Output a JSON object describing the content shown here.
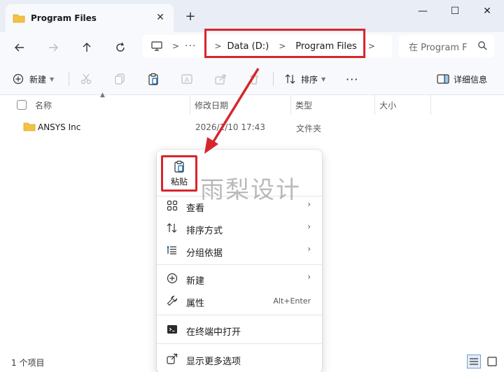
{
  "window": {
    "tab_title": "Program Files",
    "tab_close": "✕",
    "new_tab": "+",
    "minimize": "—",
    "maximize": "☐",
    "close": "✕"
  },
  "nav": {
    "more": "···",
    "sep": ">",
    "crumbs": [
      "Data (D:)",
      "Program Files"
    ],
    "search_placeholder": "在 Program F"
  },
  "toolbar": {
    "new_label": "新建",
    "sort_label": "排序",
    "more": "···",
    "details_label": "详细信息"
  },
  "columns": [
    "名称",
    "修改日期",
    "类型",
    "大小"
  ],
  "files": [
    {
      "name": "ANSYS Inc",
      "date": "2026/1/10 17:43",
      "type": "文件夹",
      "size": ""
    }
  ],
  "status": {
    "count": "1 个项目"
  },
  "context_menu": {
    "paste": "粘贴",
    "items": [
      {
        "label": "查看",
        "icon": "grid-view-icon",
        "submenu": true
      },
      {
        "label": "排序方式",
        "icon": "sort-icon",
        "submenu": true
      },
      {
        "label": "分组依据",
        "icon": "group-icon",
        "submenu": true
      },
      {
        "label": "新建",
        "icon": "plus-circle-icon",
        "submenu": true
      },
      {
        "label": "属性",
        "icon": "wrench-icon",
        "shortcut": "Alt+Enter"
      },
      {
        "label": "在终端中打开",
        "icon": "terminal-icon"
      },
      {
        "label": "显示更多选项",
        "icon": "share-icon"
      }
    ]
  },
  "watermark": "雨梨设计",
  "colors": {
    "highlight": "#d6262c",
    "folder": "#f3c244",
    "accent": "#0067c0"
  }
}
